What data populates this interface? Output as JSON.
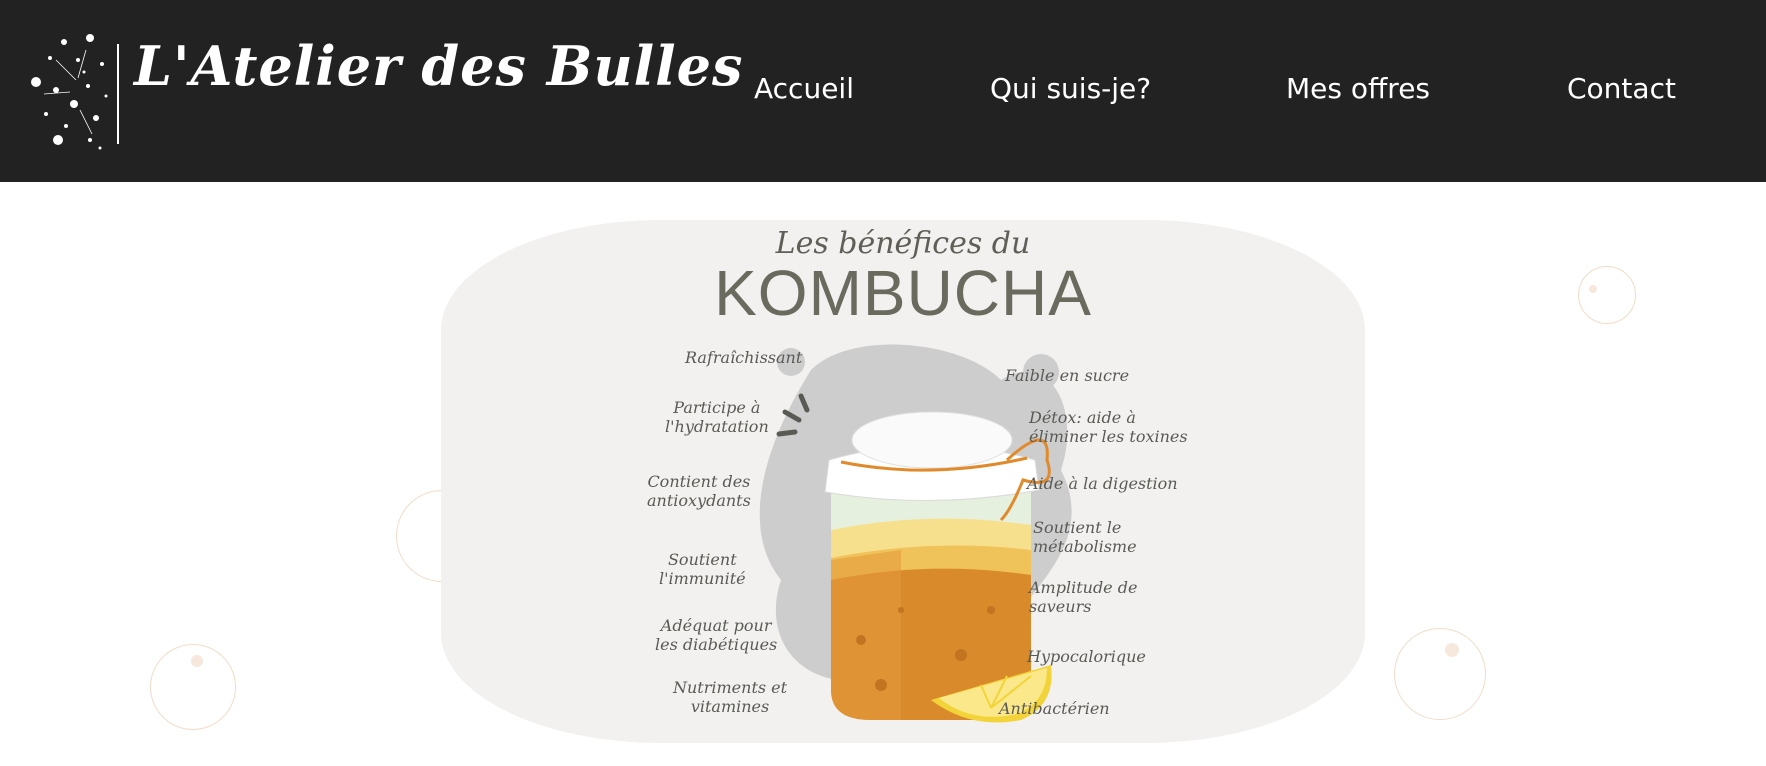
{
  "header": {
    "logo_text": "L'Atelier des Bulles",
    "nav": [
      "Accueil",
      "Qui suis-je?",
      "Mes offres",
      "Contact"
    ]
  },
  "hero": {
    "subtitle": "Les bénéfices du",
    "title": "KOMBUCHA",
    "left_benefits": [
      "Rafraîchissant",
      "Participe à\nl'hydratation",
      "Contient des\nantioxydants",
      "Soutient\nl'immunité",
      "Adéquat pour\nles diabétiques",
      "Nutriments et\nvitamines"
    ],
    "right_benefits": [
      "Faible en sucre",
      "Détox: aide à\néliminer les toxines",
      "Aide à la digestion",
      "Soutient le\nmétabolisme",
      "Amplitude de\nsaveurs",
      "Hypocalorique",
      "Antibactérien"
    ]
  },
  "colors": {
    "header_bg": "#222222",
    "nav_text": "#ffffff",
    "card_bg": "#f2f1f0",
    "bubble_stroke": "#f1dcc8",
    "kombucha_amber": "#d98a2b",
    "lemon": "#f2d43a"
  }
}
